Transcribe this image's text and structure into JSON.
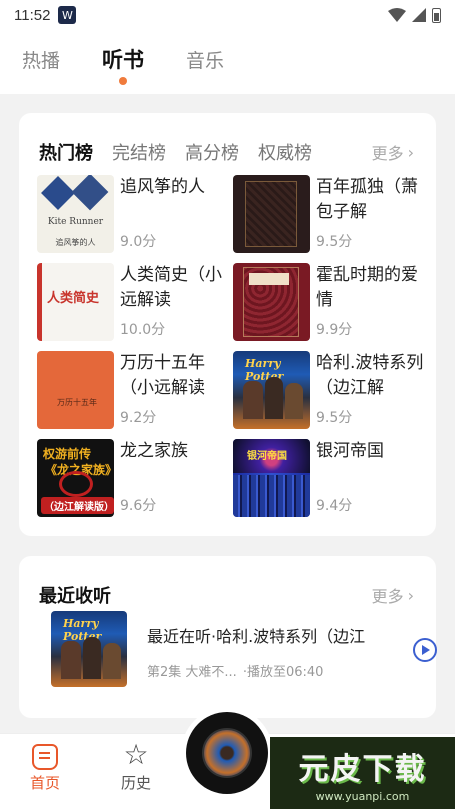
{
  "status": {
    "time": "11:52",
    "app_badge": "W"
  },
  "top_tabs": [
    {
      "label": "热播",
      "active": false
    },
    {
      "label": "听书",
      "active": true
    },
    {
      "label": "音乐",
      "active": false
    }
  ],
  "ranking": {
    "tabs": [
      {
        "label": "热门榜",
        "active": true
      },
      {
        "label": "完结榜",
        "active": false
      },
      {
        "label": "高分榜",
        "active": false
      },
      {
        "label": "权威榜",
        "active": false
      }
    ],
    "more_label": "更多",
    "books": [
      {
        "title": "追风筝的人",
        "score": "9.0分",
        "cover": "kite"
      },
      {
        "title": "百年孤独（萧包子解",
        "score": "9.5分",
        "cover": "solitude"
      },
      {
        "title": "人类简史（小远解读",
        "score": "10.0分",
        "cover": "sapiens"
      },
      {
        "title": "霍乱时期的爱情",
        "score": "9.9分",
        "cover": "love"
      },
      {
        "title": "万历十五年（小远解读",
        "score": "9.2分",
        "cover": "wanli"
      },
      {
        "title": "哈利.波特系列（边江解",
        "score": "9.5分",
        "cover": "hp"
      },
      {
        "title": "龙之家族",
        "score": "9.6分",
        "cover": "dragon"
      },
      {
        "title": "银河帝国",
        "score": "9.4分",
        "cover": "galaxy"
      }
    ],
    "cover_text": {
      "kite_title": "Kite Runner",
      "kite_cn": "追风筝的人",
      "sapiens_cn": "人类简史",
      "wanli_cn": "万历十五年",
      "hp_logo": "Harry Potter",
      "dragon_l1": "权游前传",
      "dragon_l2": "《龙之家族》",
      "dragon_l3": "（边江解读版）",
      "galaxy_cn": "银河帝国"
    }
  },
  "recent": {
    "title": "最近收听",
    "more_label": "更多",
    "item": {
      "name": "最近在听·哈利.波特系列（边江",
      "episode": "第2集 大难不...",
      "progress": "·播放至06:40"
    }
  },
  "bottom_nav": {
    "home_label": "首页",
    "history_label": "历史"
  },
  "watermark": {
    "main": "元皮下载",
    "sub": "www.yuanpi.com"
  },
  "colors": {
    "accent": "#e8572a",
    "dot": "#f07b3c",
    "play": "#3b5fd0"
  }
}
